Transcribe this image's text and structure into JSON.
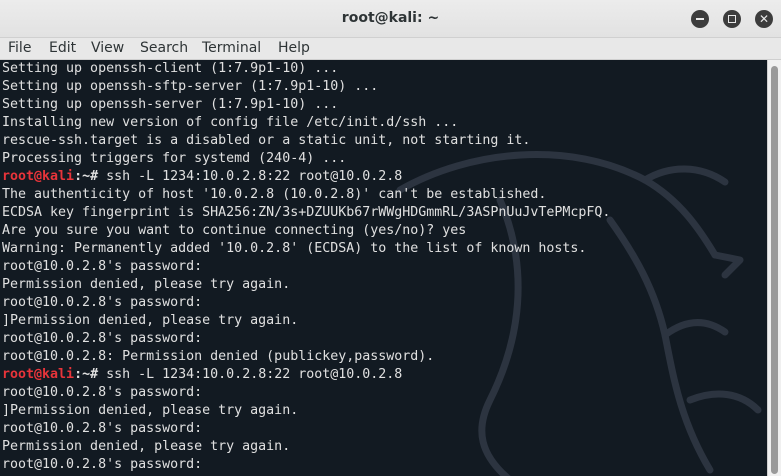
{
  "window": {
    "title": "root@kali: ~",
    "minimize_glyph": "",
    "maximize_glyph": "",
    "close_glyph": "✕"
  },
  "menu": [
    "File",
    "Edit",
    "View",
    "Search",
    "Terminal",
    "Help"
  ],
  "terminal": {
    "lines": [
      {
        "text": "Setting up openssh-client (1:7.9p1-10) ..."
      },
      {
        "text": "Setting up openssh-sftp-server (1:7.9p1-10) ..."
      },
      {
        "text": "Setting up openssh-server (1:7.9p1-10) ..."
      },
      {
        "text": "Installing new version of config file /etc/init.d/ssh ..."
      },
      {
        "text": "rescue-ssh.target is a disabled or a static unit, not starting it."
      },
      {
        "text": "Processing triggers for systemd (240-4) ..."
      },
      {
        "prompt_user": "root@kali",
        "prompt_sep": ":~#",
        "command": " ssh -L 1234:10.0.2.8:22 root@10.0.2.8"
      },
      {
        "text": "The authenticity of host '10.0.2.8 (10.0.2.8)' can't be established."
      },
      {
        "text": "ECDSA key fingerprint is SHA256:ZN/3s+DZUUKb67rWWgHDGmmRL/3ASPnUuJvTePMcpFQ."
      },
      {
        "text": "Are you sure you want to continue connecting (yes/no)? yes"
      },
      {
        "text": "Warning: Permanently added '10.0.2.8' (ECDSA) to the list of known hosts."
      },
      {
        "text": "root@10.0.2.8's password:"
      },
      {
        "text": "Permission denied, please try again."
      },
      {
        "text": "root@10.0.2.8's password:"
      },
      {
        "text": "]Permission denied, please try again."
      },
      {
        "text": "root@10.0.2.8's password:"
      },
      {
        "text": "root@10.0.2.8: Permission denied (publickey,password)."
      },
      {
        "prompt_user": "root@kali",
        "prompt_sep": ":~#",
        "command": " ssh -L 1234:10.0.2.8:22 root@10.0.2.8"
      },
      {
        "text": "root@10.0.2.8's password:"
      },
      {
        "text": "]Permission denied, please try again."
      },
      {
        "text": "root@10.0.2.8's password:"
      },
      {
        "text": "Permission denied, please try again."
      },
      {
        "text": "root@10.0.2.8's password:"
      }
    ]
  },
  "colors": {
    "terminal_bg": "#121a22",
    "terminal_fg": "#e0e0e0",
    "prompt_user": "#e8343a",
    "dragon": "#2c3440"
  },
  "icons": {
    "minimize": "minimize-icon",
    "maximize": "maximize-icon",
    "close": "close-icon",
    "background": "kali-dragon-icon"
  }
}
